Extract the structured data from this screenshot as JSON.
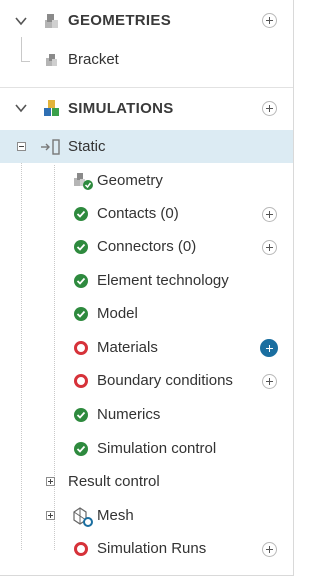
{
  "geometries": {
    "title": "GEOMETRIES",
    "items": [
      {
        "label": "Bracket"
      }
    ]
  },
  "simulations": {
    "title": "SIMULATIONS",
    "analysis": {
      "label": "Static"
    },
    "children": [
      {
        "label": "Geometry",
        "status": "geometry-ok"
      },
      {
        "label": "Contacts (0)",
        "status": "ok",
        "addable": true
      },
      {
        "label": "Connectors (0)",
        "status": "ok",
        "addable": true
      },
      {
        "label": "Element technology",
        "status": "ok"
      },
      {
        "label": "Model",
        "status": "ok"
      },
      {
        "label": "Materials",
        "status": "error",
        "addable": true,
        "highlight_add": true
      },
      {
        "label": "Boundary conditions",
        "status": "error",
        "addable": true
      },
      {
        "label": "Numerics",
        "status": "ok"
      },
      {
        "label": "Simulation control",
        "status": "ok"
      },
      {
        "label": "Result control",
        "status": "collapsed"
      },
      {
        "label": "Mesh",
        "status": "collapsed-mesh"
      },
      {
        "label": "Simulation Runs",
        "status": "error",
        "addable": true
      }
    ]
  },
  "colors": {
    "ok": "#2e8a3e",
    "error": "#d6323a",
    "accent": "#1a6ea0",
    "selected_row": "#dcebf3"
  }
}
